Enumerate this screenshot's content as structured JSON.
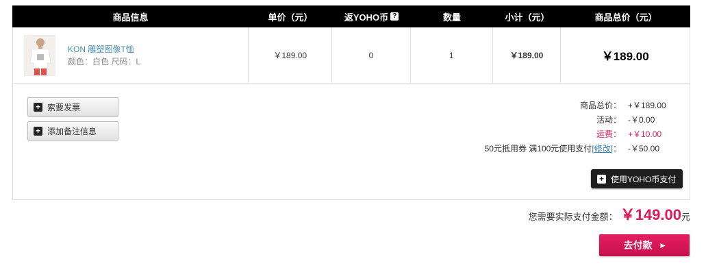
{
  "header": {
    "product_info": "商品信息",
    "unit_price": "单价（元）",
    "yoho_coin": "返YOHO币",
    "help_symbol": "?",
    "quantity": "数量",
    "subtotal": "小计（元）",
    "product_total": "商品总价（元）"
  },
  "product": {
    "name": "KON 雕塑图像T恤",
    "attributes": "颜色：白色 尺码：L",
    "unit_price": "￥189.00",
    "yoho_coin": "0",
    "quantity": "1",
    "subtotal": "￥189.00",
    "total": "￥189.00",
    "thumbnail_icon": "tshirt-model-photo"
  },
  "actions": {
    "invoice_label": "索要发票",
    "remark_label": "添加备注信息",
    "plus_symbol": "+",
    "use_yoho_label": "使用YOHO币支付"
  },
  "summary": {
    "goods_total_label": "商品总价：",
    "goods_total_value": "+￥189.00",
    "activity_label": "活动：",
    "activity_value": "-￥0.00",
    "shipping_label": "运费：",
    "shipping_value": "+￥10.00",
    "coupon_label": "50元抵用券 满100元使用支付",
    "coupon_link": "[修改]",
    "coupon_colon": "：",
    "coupon_value": "-￥50.00"
  },
  "payment": {
    "label": "您需要实际支付金额：",
    "amount": "￥149.00",
    "unit": "元",
    "pay_button": "去付款",
    "arrow": "▶"
  },
  "colors": {
    "accent": "#e0185a",
    "header_bg": "#000000",
    "link": "#4a8fb0"
  }
}
